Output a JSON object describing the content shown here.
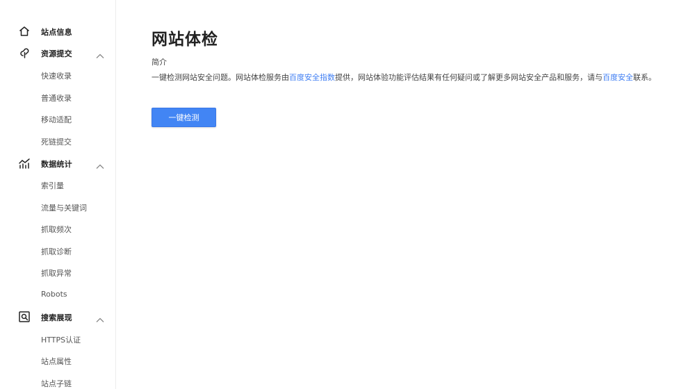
{
  "sidebar": {
    "site_info": {
      "label": "站点信息",
      "icon": "home-icon"
    },
    "resource_submit": {
      "label": "资源提交",
      "icon": "link-icon",
      "expanded": true,
      "items": [
        "快速收录",
        "普通收录",
        "移动适配",
        "死链提交"
      ]
    },
    "data_stats": {
      "label": "数据统计",
      "icon": "stats-icon",
      "expanded": true,
      "items": [
        "索引量",
        "流量与关键词",
        "抓取频次",
        "抓取诊断",
        "抓取异常",
        "Robots"
      ]
    },
    "search_display": {
      "label": "搜索展现",
      "icon": "search-display-icon",
      "expanded": true,
      "items": [
        "HTTPS认证",
        "站点属性",
        "站点子链"
      ]
    }
  },
  "main": {
    "title": "网站体检",
    "intro_heading": "简介",
    "intro": {
      "part1": "一键检测网站安全问题。网站体检服务由",
      "link1": "百度安全指数",
      "part2": "提供，网站体验功能评估结果有任何疑问或了解更多网站安全产品和服务，请与",
      "link2": "百度安全",
      "part3": "联系。"
    },
    "button_label": "一键检测"
  },
  "colors": {
    "accent": "#4285f4",
    "link": "#3f7ef3"
  }
}
